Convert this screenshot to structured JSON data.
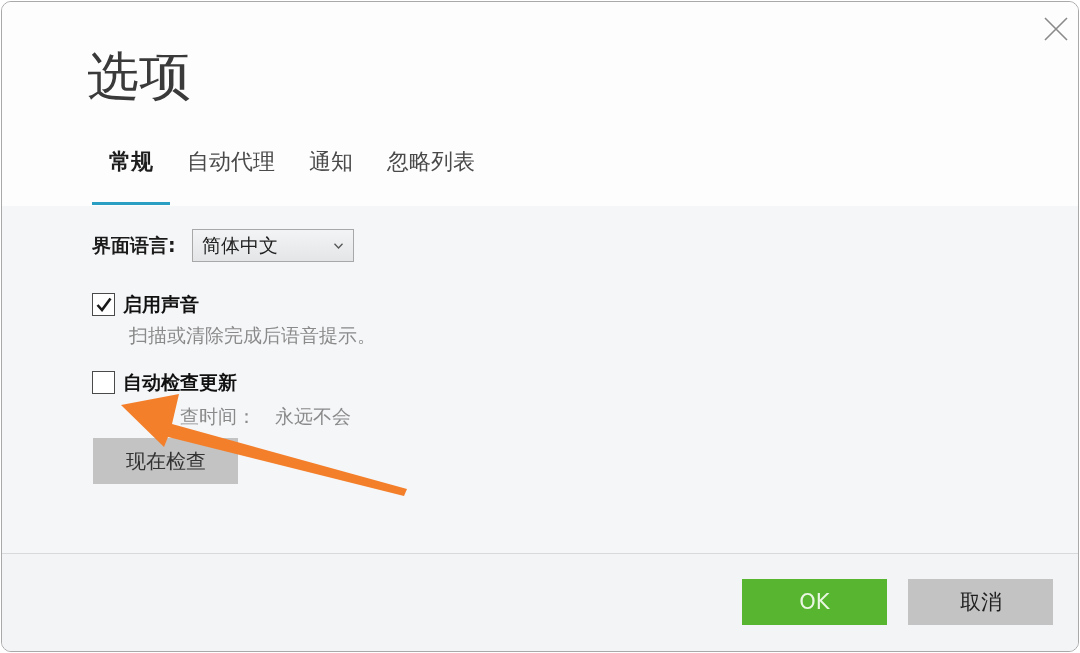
{
  "window": {
    "title": "选项"
  },
  "tabs": [
    {
      "label": "常规",
      "selected": true
    },
    {
      "label": "自动代理",
      "selected": false
    },
    {
      "label": "通知",
      "selected": false
    },
    {
      "label": "忽略列表",
      "selected": false
    }
  ],
  "language": {
    "label": "界面语言:",
    "value": "简体中文"
  },
  "options": [
    {
      "label": "启用声音",
      "checked": true,
      "description": "扫描或清除完成后语音提示。"
    },
    {
      "label": "自动检查更新",
      "checked": false,
      "status_label": "查时间：",
      "status_value": "永远不会"
    }
  ],
  "check_now_button": {
    "label": "现在检查"
  },
  "buttons": [
    {
      "label": "OK",
      "kind": "primary"
    },
    {
      "label": "取消",
      "kind": "secondary"
    }
  ]
}
